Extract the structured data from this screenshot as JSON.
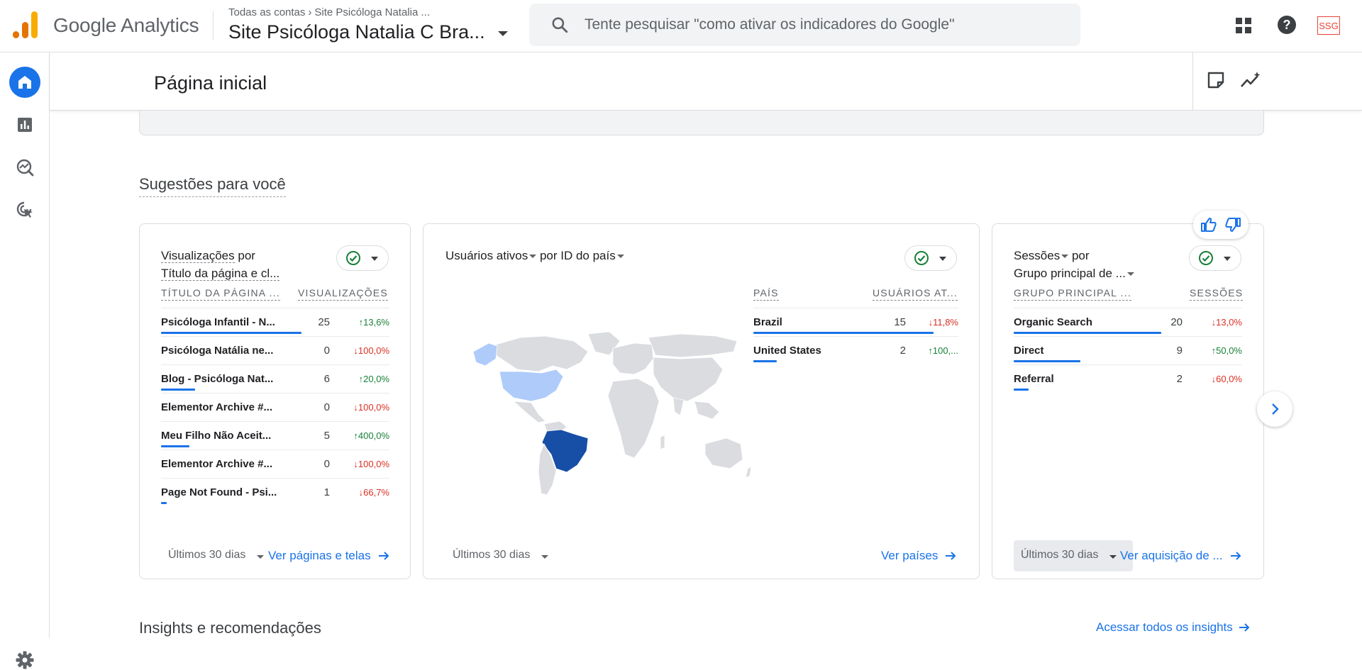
{
  "app": {
    "brand": "Google Analytics",
    "breadcrumb": [
      "Todas as contas",
      "Site Psicóloga Natalia ..."
    ],
    "property": "Site Psicóloga Natalia C Bra...",
    "search_placeholder": "Tente pesquisar \"como ativar os indicadores do Google\"",
    "avatar_text": "SSG",
    "accent_color": "#1a73e8"
  },
  "page": {
    "title": "Página inicial",
    "suggestions_title": "Sugestões para você",
    "insights_title": "Insights e recomendações",
    "insights_link": "Acessar todos os insights"
  },
  "cards": {
    "pages": {
      "title_metric": "Visualizações",
      "title_by": "por",
      "title_dim": "Título da página e cl...",
      "col_dim": "TÍTULO DA PÁGINA ...",
      "col_metric": "VISUALIZAÇÕES",
      "rows": [
        {
          "label": "Psicóloga Infantil - N...",
          "value": "25",
          "change": "13,6%",
          "dir": "up",
          "share": 1.0
        },
        {
          "label": "Psicóloga Natália ne...",
          "value": "0",
          "change": "100,0%",
          "dir": "down",
          "share": 0.0
        },
        {
          "label": "Blog - Psicóloga Nat...",
          "value": "6",
          "change": "20,0%",
          "dir": "up",
          "share": 0.24
        },
        {
          "label": "Elementor Archive #...",
          "value": "0",
          "change": "100,0%",
          "dir": "down",
          "share": 0.0
        },
        {
          "label": "Meu Filho Não Aceit...",
          "value": "5",
          "change": "400,0%",
          "dir": "up",
          "share": 0.2
        },
        {
          "label": "Elementor Archive #...",
          "value": "0",
          "change": "100,0%",
          "dir": "down",
          "share": 0.0
        },
        {
          "label": "Page Not Found - Psi...",
          "value": "1",
          "change": "66,7%",
          "dir": "down",
          "share": 0.04
        }
      ],
      "range": "Últimos 30 dias",
      "link": "Ver páginas e telas"
    },
    "countries": {
      "title_metric": "Usuários ativos",
      "title_by": "por ID do país",
      "col_dim": "PAÍS",
      "col_metric": "USUÁRIOS AT...",
      "rows": [
        {
          "label": "Brazil",
          "value": "15",
          "change": "11,8%",
          "dir": "down",
          "share": 1.0
        },
        {
          "label": "United States",
          "value": "2",
          "change": "100,...",
          "dir": "up",
          "share": 0.13
        }
      ],
      "map_colors": {
        "high": "#174ea6",
        "low": "#aecbfa",
        "none": "#dadce0"
      },
      "range": "Últimos 30 dias",
      "link": "Ver países"
    },
    "sessions": {
      "title_metric": "Sessões",
      "title_by": "por",
      "title_dim": "Grupo principal de ...",
      "col_dim": "GRUPO PRINCIPAL ...",
      "col_metric": "SESSÕES",
      "rows": [
        {
          "label": "Organic Search",
          "value": "20",
          "change": "13,0%",
          "dir": "down",
          "share": 1.0
        },
        {
          "label": "Direct",
          "value": "9",
          "change": "50,0%",
          "dir": "up",
          "share": 0.45
        },
        {
          "label": "Referral",
          "value": "2",
          "change": "60,0%",
          "dir": "down",
          "share": 0.1
        }
      ],
      "range": "Últimos 30 dias",
      "link": "Ver aquisição de ..."
    }
  }
}
